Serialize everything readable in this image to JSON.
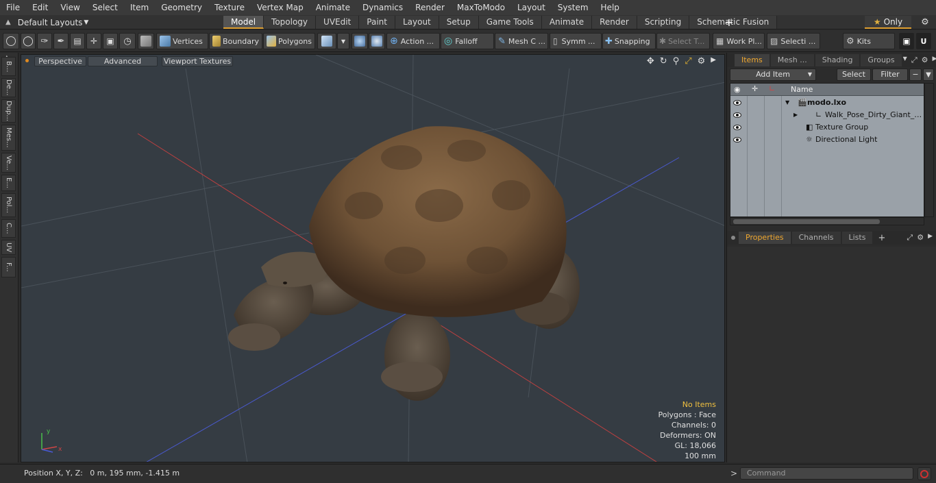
{
  "menu": [
    "File",
    "Edit",
    "View",
    "Select",
    "Item",
    "Geometry",
    "Texture",
    "Vertex Map",
    "Animate",
    "Dynamics",
    "Render",
    "MaxToModo",
    "Layout",
    "System",
    "Help"
  ],
  "layouts_dropdown": "Default Layouts",
  "layout_tabs": [
    {
      "label": "Model",
      "active": true
    },
    {
      "label": "Topology"
    },
    {
      "label": "UVEdit"
    },
    {
      "label": "Paint"
    },
    {
      "label": "Layout"
    },
    {
      "label": "Setup"
    },
    {
      "label": "Game Tools"
    },
    {
      "label": "Animate"
    },
    {
      "label": "Render"
    },
    {
      "label": "Scripting"
    },
    {
      "label": "Schematic Fusion"
    }
  ],
  "tab_add": "+",
  "only_label": "Only",
  "toolbar": {
    "vertices": "Vertices",
    "boundary": "Boundary",
    "polygons": "Polygons",
    "action": "Action ...",
    "falloff": "Falloff",
    "mesh": "Mesh C ...",
    "symmetry": "Symm ...",
    "snapping": "Snapping",
    "select_t": "Select T...",
    "work_plane": "Work Pl...",
    "selection": "Selecti ...",
    "kits": "Kits"
  },
  "left_tabs": [
    "B...",
    "De...",
    "Dup...",
    "Mes...",
    "Ve...",
    "E...",
    "Pol...",
    "C...",
    "UV",
    "F..."
  ],
  "viewport": {
    "perspective": "Perspective",
    "advanced": "Advanced",
    "textures": "Viewport Textures",
    "stats": {
      "items": "No Items",
      "polygons": "Polygons : Face",
      "channels": "Channels: 0",
      "deformers": "Deformers: ON",
      "gl": "GL: 18,066",
      "scale": "100 mm"
    }
  },
  "items_panel": {
    "tabs": [
      {
        "label": "Items",
        "active": true
      },
      {
        "label": "Mesh ..."
      },
      {
        "label": "Shading"
      },
      {
        "label": "Groups"
      }
    ],
    "add_item": "Add Item",
    "select": "Select",
    "filter": "Filter",
    "name_header": "Name",
    "tree": [
      {
        "name": "modo.lxo",
        "bold": true
      },
      {
        "name": "Walk_Pose_Dirty_Giant_Tort ..."
      },
      {
        "name": "Texture Group"
      },
      {
        "name": "Directional Light"
      }
    ]
  },
  "props_panel": {
    "tabs": [
      {
        "label": "Properties",
        "active": true
      },
      {
        "label": "Channels"
      },
      {
        "label": "Lists"
      }
    ],
    "add": "+"
  },
  "status": {
    "position": "Position X, Y, Z:   0 m, 195 mm, -1.415 m",
    "command_placeholder": "Command"
  },
  "colors": {
    "accent": "#e0a030",
    "viewport_bg": "#353c43",
    "x_axis": "#d04545",
    "z_axis": "#4a5ad8"
  }
}
